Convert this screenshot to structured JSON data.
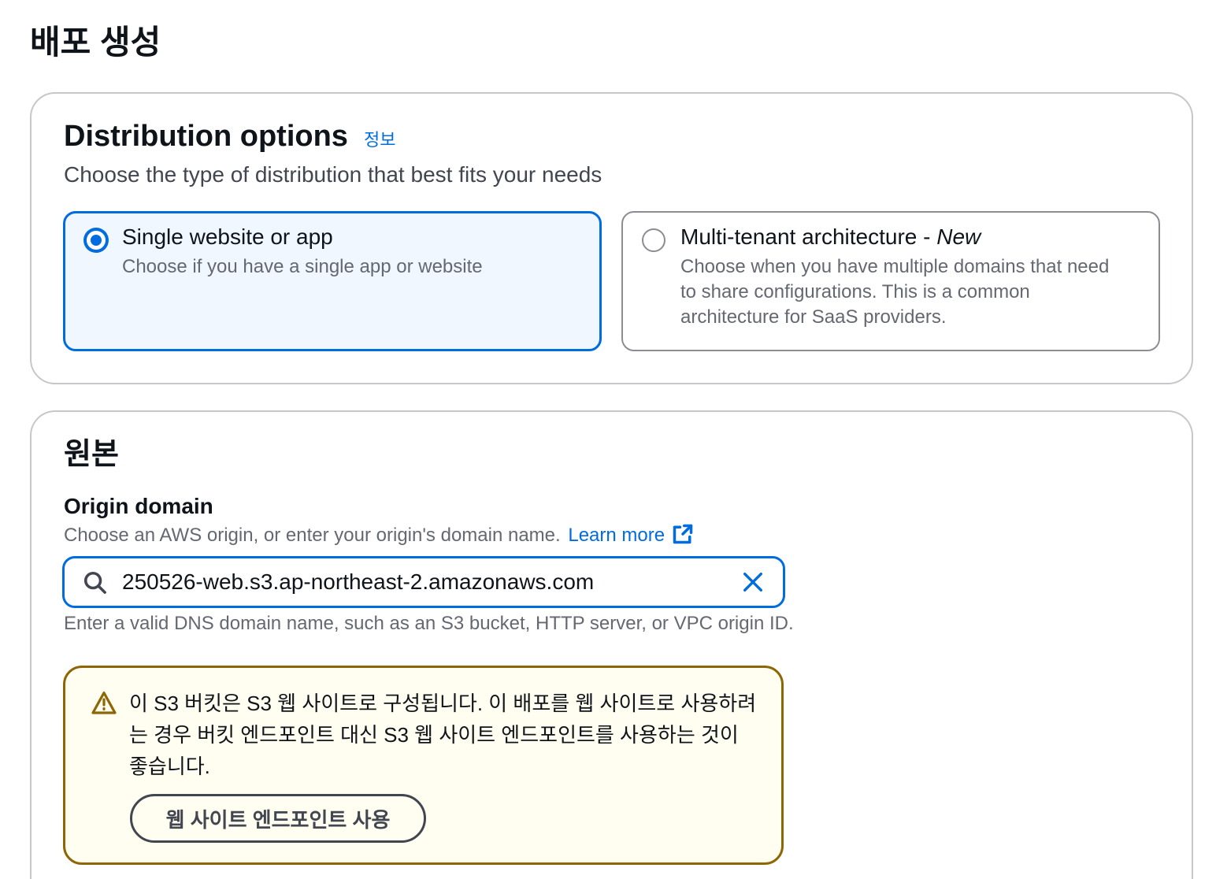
{
  "page": {
    "title": "배포 생성"
  },
  "distribution_options": {
    "heading": "Distribution options",
    "info_link": "정보",
    "description": "Choose the type of distribution that best fits your needs",
    "options": [
      {
        "title": "Single website or app",
        "description": "Choose if you have a single app or website",
        "selected": true
      },
      {
        "title": "Multi-tenant architecture -",
        "badge": "New",
        "description": "Choose when you have multiple domains that need to share configurations. This is a common architecture for SaaS providers.",
        "selected": false
      }
    ]
  },
  "origin": {
    "heading": "원본",
    "field_label": "Origin domain",
    "field_description": "Choose an AWS origin, or enter your origin's domain name.",
    "learn_more": "Learn more",
    "input_value": "250526-web.s3.ap-northeast-2.amazonaws.com",
    "constraint": "Enter a valid DNS domain name, such as an S3 bucket, HTTP server, or VPC origin ID.",
    "alert": {
      "message": "이 S3 버킷은 S3 웹 사이트로 구성됩니다. 이 배포를 웹 사이트로 사용하려는 경우 버킷 엔드포인트 대신 S3 웹 사이트 엔드포인트를 사용하는 것이 좋습니다.",
      "action_label": "웹 사이트 엔드포인트 사용"
    }
  },
  "icons": {
    "search": "search-icon",
    "clear": "close-icon",
    "external_link": "external-link-icon",
    "warning": "warning-icon"
  },
  "theme": {
    "accent": "#006ce0",
    "text_primary": "#0f141a",
    "text_secondary": "#656871",
    "text_header_description": "#424650",
    "warning": "#8d6605",
    "warning_bg": "#fffef0",
    "selected_bg": "#f0f7fe",
    "container_border": "#c6c6cd",
    "tile_border": "#8c8c94",
    "button_border": "#424650"
  }
}
